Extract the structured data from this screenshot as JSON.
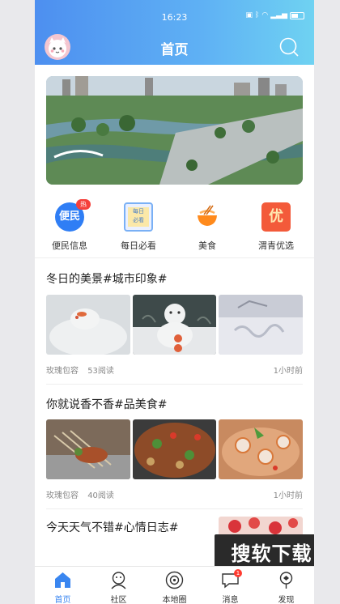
{
  "status": {
    "time": "16:23",
    "battery": "31"
  },
  "header": {
    "title": "首页"
  },
  "quick_nav": [
    {
      "label": "便民信息",
      "icon_text": "便民",
      "badge": "热",
      "icon": "convenience-icon",
      "color": "#2f7ef5"
    },
    {
      "label": "每日必看",
      "icon_text": "每日\n必看",
      "icon": "daily-icon",
      "color": "#f0a23c"
    },
    {
      "label": "美食",
      "icon": "bowl-icon",
      "color": "#ff8a1c"
    },
    {
      "label": "渭青优选",
      "icon_text": "优",
      "icon": "shop-icon",
      "color": "#f35a3a"
    }
  ],
  "posts": [
    {
      "title": "冬日的美景#城市印象#",
      "author": "玫瑰包容",
      "reads": "53阅读",
      "time": "1小时前"
    },
    {
      "title": "你就说香不香#品美食#",
      "author": "玫瑰包容",
      "reads": "40阅读",
      "time": "1小时前"
    },
    {
      "title": "今天天气不错#心情日志#"
    }
  ],
  "watermark": "搜软下载",
  "tabbar": [
    {
      "label": "首页",
      "icon": "home-icon",
      "active": true
    },
    {
      "label": "社区",
      "icon": "community-icon"
    },
    {
      "label": "本地圈",
      "icon": "local-circle-icon"
    },
    {
      "label": "消息",
      "icon": "message-icon",
      "badge": "1"
    },
    {
      "label": "发现",
      "icon": "discover-icon"
    }
  ],
  "colors": {
    "accent": "#3a86f0",
    "header_start": "#4d8ff0",
    "header_end": "#6fd2f2"
  }
}
